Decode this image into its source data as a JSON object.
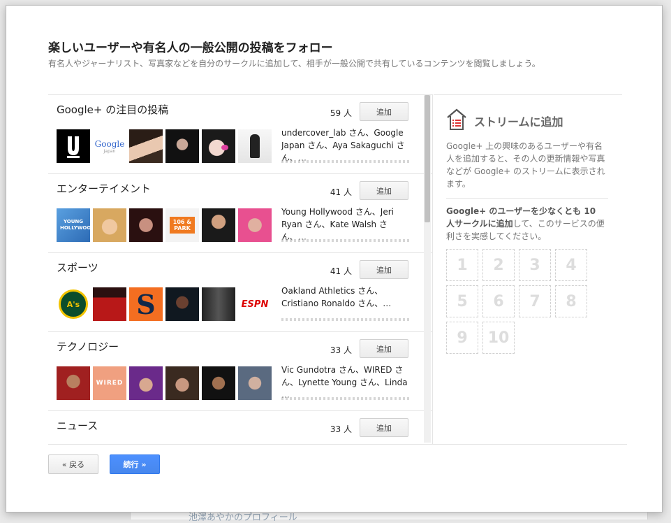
{
  "dialog": {
    "title": "楽しいユーザーや有名人の一般公開の投稿をフォロー",
    "subtitle": "有名人やジャーナリスト、写真家などを自分のサークルに追加して、相手が一般公開で共有しているコンテンツを閲覧しましょう。"
  },
  "categories": [
    {
      "name": "Google+ の注目の投稿",
      "count": "59 人",
      "add_label": "追加",
      "description": "undercover_lab さん、Google Japan さん、Aya Sakaguchi さん、…"
    },
    {
      "name": "エンターテイメント",
      "count": "41 人",
      "add_label": "追加",
      "description": "Young Hollywood さん、Jeri Ryan さん、Kate Walsh さん、…"
    },
    {
      "name": "スポーツ",
      "count": "41 人",
      "add_label": "追加",
      "description": "Oakland Athletics さん、Cristiano Ronaldo さん、…"
    },
    {
      "name": "テクノロジー",
      "count": "33 人",
      "add_label": "追加",
      "description": "Vic Gundotra さん、WIRED さん、Lynette Young さん、Linda …"
    },
    {
      "name": "ニュース",
      "count": "33 人",
      "add_label": "追加",
      "description": ""
    }
  ],
  "avatar_texts": {
    "google": "Google",
    "google_sub": "Japan",
    "young_hollywood": "YOUNG HOLLYWOOD",
    "park_106": "106 & PARK",
    "athletics": "A's",
    "espn": "ESPN",
    "wired": "WIRED"
  },
  "stream": {
    "title": "ストリームに追加",
    "description": "Google+ 上の興味のあるユーザーや有名人を追加すると、その人の更新情報や写真などが Google+ のストリームに表示されます。",
    "goal_bold": "Google+ のユーザーを少なくとも 10 人サークルに追加",
    "goal_rest": "して、このサービスの便利さを実感してください。",
    "slots": [
      "1",
      "2",
      "3",
      "4",
      "5",
      "6",
      "7",
      "8",
      "9",
      "10"
    ]
  },
  "footer": {
    "back_label": "« 戻る",
    "next_label": "続行 »"
  },
  "background": {
    "link_text": "池澤あやかのプロフィール"
  },
  "colors": {
    "primary_button": "#4d90fe",
    "text_muted": "#777777"
  }
}
